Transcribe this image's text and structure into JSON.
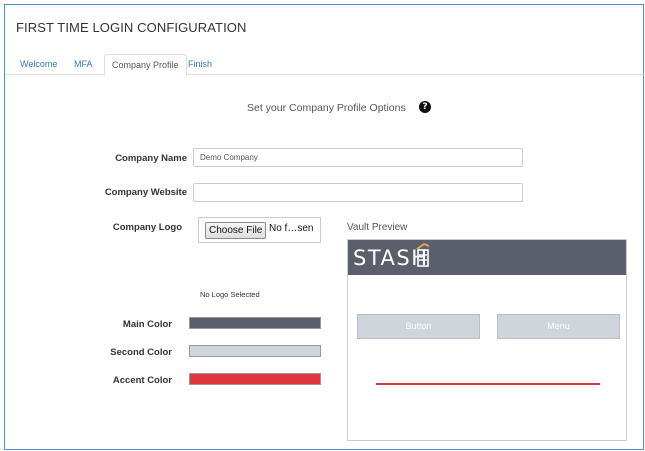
{
  "page": {
    "title": "FIRST TIME LOGIN CONFIGURATION"
  },
  "tabs": [
    {
      "label": "Welcome",
      "active": false
    },
    {
      "label": "MFA",
      "active": false
    },
    {
      "label": "Company Profile",
      "active": true
    },
    {
      "label": "Finish",
      "active": false
    }
  ],
  "section": {
    "heading": "Set your Company Profile Options",
    "help_icon": "question-circle-icon",
    "help_glyph": "?"
  },
  "form": {
    "company_name": {
      "label": "Company Name",
      "value": "Demo Company"
    },
    "company_website": {
      "label": "Company Website",
      "value": ""
    },
    "company_logo": {
      "label": "Company Logo",
      "button_label": "Choose File",
      "file_status": "No f…sen",
      "no_logo_text": "No Logo Selected"
    },
    "main_color": {
      "label": "Main Color",
      "value": "#5a5f6b"
    },
    "second_color": {
      "label": "Second Color",
      "value": "#cfd5db"
    },
    "accent_color": {
      "label": "Accent Color",
      "value": "#e0353d"
    }
  },
  "preview": {
    "label": "Vault Preview",
    "logo_text": "STASH",
    "button_label": "Button",
    "menu_label": "Menu"
  },
  "colors": {
    "link": "#337ab7",
    "accent_mark": "#e8a84a"
  }
}
